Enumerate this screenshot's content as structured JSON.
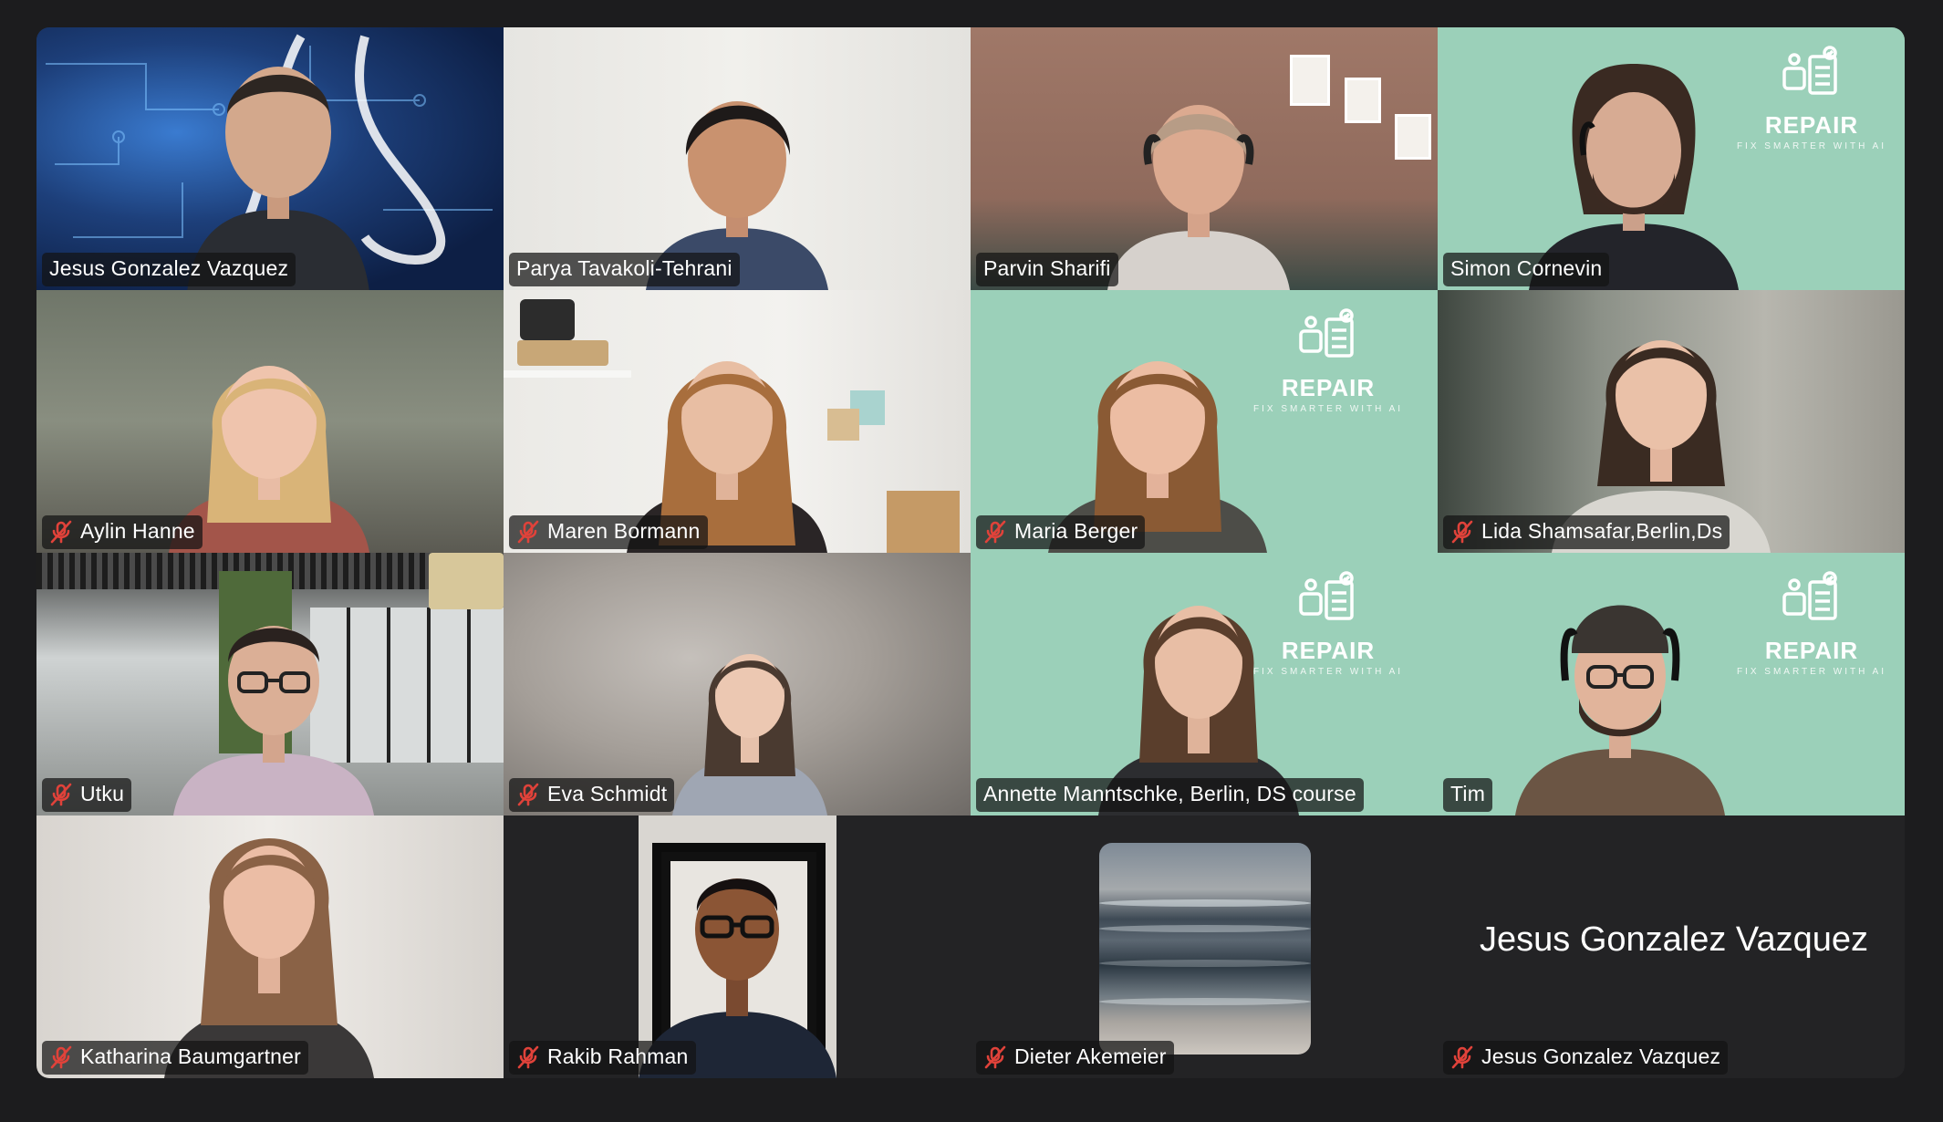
{
  "window": {
    "active_speaker": "Parya Tavakoli-Tehrani"
  },
  "colors": {
    "background": "#1c1c1e",
    "active_speaker_border": "#35c759",
    "repair_bg": "#9bd0b9",
    "mute_icon": "#e0423a"
  },
  "repair_logo": {
    "brand": "REPAIR",
    "tagline": "FIX SMARTER WITH AI"
  },
  "participants": [
    {
      "name": "Jesus Gonzalez Vazquez",
      "muted": false,
      "video": "on"
    },
    {
      "name": "Parya Tavakoli-Tehrani",
      "muted": false,
      "video": "on",
      "speaking": true
    },
    {
      "name": "Parvin Sharifi",
      "muted": false,
      "video": "on"
    },
    {
      "name": "Simon Cornevin",
      "muted": false,
      "video": "on"
    },
    {
      "name": "Aylin Hanne",
      "muted": true,
      "video": "on"
    },
    {
      "name": "Maren Bormann",
      "muted": true,
      "video": "on"
    },
    {
      "name": "Maria Berger",
      "muted": true,
      "video": "on"
    },
    {
      "name": "Lida Shamsafar,Berlin,Ds",
      "muted": true,
      "video": "on"
    },
    {
      "name": "Utku",
      "muted": true,
      "video": "on"
    },
    {
      "name": "Eva Schmidt",
      "muted": true,
      "video": "on"
    },
    {
      "name": "Annette Manntschke, Berlin, DS course",
      "muted": false,
      "video": "on"
    },
    {
      "name": "Tim",
      "muted": false,
      "video": "on"
    },
    {
      "name": "Katharina Baumgartner",
      "muted": true,
      "video": "on"
    },
    {
      "name": "Rakib Rahman",
      "muted": true,
      "video": "on"
    },
    {
      "name": "Dieter Akemeier",
      "muted": true,
      "video": "off",
      "avatar": "ocean-waves"
    },
    {
      "name": "Jesus Gonzalez Vazquez",
      "muted": true,
      "video": "off",
      "display_name_large": "Jesus Gonzalez Vazquez"
    }
  ]
}
